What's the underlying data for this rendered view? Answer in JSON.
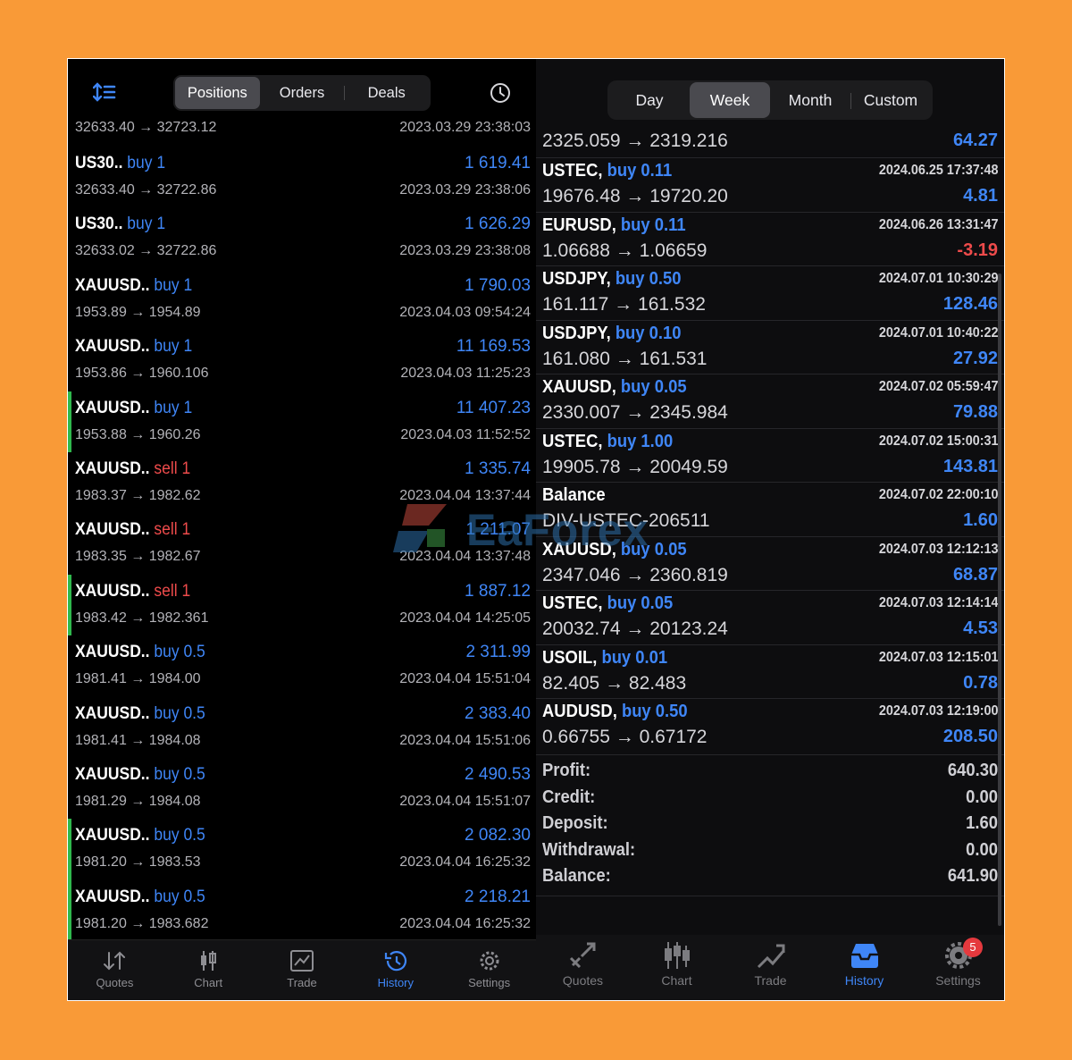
{
  "left": {
    "tabs": [
      "Positions",
      "Orders",
      "Deals"
    ],
    "first_row": {
      "prices": "32633.40 → 32723.12",
      "time": "2023.03.29 23:38:03"
    },
    "rows": [
      {
        "name": "US30..",
        "side": "buy",
        "volume": "1",
        "prices": "32633.40 → 32722.86",
        "profit": "1 619.41",
        "time": "2023.03.29 23:38:06",
        "mark": false
      },
      {
        "name": "US30..",
        "side": "buy",
        "volume": "1",
        "prices": "32633.02 → 32722.86",
        "profit": "1 626.29",
        "time": "2023.03.29 23:38:08",
        "mark": false
      },
      {
        "name": "XAUUSD..",
        "side": "buy",
        "volume": "1",
        "prices": "1953.89 → 1954.89",
        "profit": "1 790.03",
        "time": "2023.04.03 09:54:24",
        "mark": false
      },
      {
        "name": "XAUUSD..",
        "side": "buy",
        "volume": "1",
        "prices": "1953.86 → 1960.106",
        "profit": "11 169.53",
        "time": "2023.04.03 11:25:23",
        "mark": false
      },
      {
        "name": "XAUUSD..",
        "side": "buy",
        "volume": "1",
        "prices": "1953.88 → 1960.26",
        "profit": "11 407.23",
        "time": "2023.04.03 11:52:52",
        "mark": true
      },
      {
        "name": "XAUUSD..",
        "side": "sell",
        "volume": "1",
        "prices": "1983.37 → 1982.62",
        "profit": "1 335.74",
        "time": "2023.04.04 13:37:44",
        "mark": false
      },
      {
        "name": "XAUUSD..",
        "side": "sell",
        "volume": "1",
        "prices": "1983.35 → 1982.67",
        "profit": "1 211.07",
        "time": "2023.04.04 13:37:48",
        "mark": false
      },
      {
        "name": "XAUUSD..",
        "side": "sell",
        "volume": "1",
        "prices": "1983.42 → 1982.361",
        "profit": "1 887.12",
        "time": "2023.04.04 14:25:05",
        "mark": true
      },
      {
        "name": "XAUUSD..",
        "side": "buy",
        "volume": "0.5",
        "prices": "1981.41 → 1984.00",
        "profit": "2 311.99",
        "time": "2023.04.04 15:51:04",
        "mark": false
      },
      {
        "name": "XAUUSD..",
        "side": "buy",
        "volume": "0.5",
        "prices": "1981.41 → 1984.08",
        "profit": "2 383.40",
        "time": "2023.04.04 15:51:06",
        "mark": false
      },
      {
        "name": "XAUUSD..",
        "side": "buy",
        "volume": "0.5",
        "prices": "1981.29 → 1984.08",
        "profit": "2 490.53",
        "time": "2023.04.04 15:51:07",
        "mark": false
      },
      {
        "name": "XAUUSD..",
        "side": "buy",
        "volume": "0.5",
        "prices": "1981.20 → 1983.53",
        "profit": "2 082.30",
        "time": "2023.04.04 16:25:32",
        "mark": true
      },
      {
        "name": "XAUUSD..",
        "side": "buy",
        "volume": "0.5",
        "prices": "1981.20 → 1983.682",
        "profit": "2 218.21",
        "time": "2023.04.04 16:25:32",
        "mark": true
      }
    ],
    "tabbar": [
      "Quotes",
      "Chart",
      "Trade",
      "History",
      "Settings"
    ]
  },
  "right": {
    "periods": [
      "Day",
      "Week",
      "Month",
      "Custom"
    ],
    "first_row": {
      "prices": "2325.059 → 2319.216",
      "profit": "64.27"
    },
    "rows": [
      {
        "name": "USTEC,",
        "action": "buy 0.11",
        "time": "2024.06.25 17:37:48",
        "prices": "19676.48 → 19720.20",
        "profit": "4.81",
        "neg": false
      },
      {
        "name": "EURUSD,",
        "action": "buy 0.11",
        "time": "2024.06.26 13:31:47",
        "prices": "1.06688 → 1.06659",
        "profit": "-3.19",
        "neg": true
      },
      {
        "name": "USDJPY,",
        "action": "buy 0.50",
        "time": "2024.07.01 10:30:29",
        "prices": "161.117 → 161.532",
        "profit": "128.46",
        "neg": false
      },
      {
        "name": "USDJPY,",
        "action": "buy 0.10",
        "time": "2024.07.01 10:40:22",
        "prices": "161.080 → 161.531",
        "profit": "27.92",
        "neg": false
      },
      {
        "name": "XAUUSD,",
        "action": "buy 0.05",
        "time": "2024.07.02 05:59:47",
        "prices": "2330.007 → 2345.984",
        "profit": "79.88",
        "neg": false
      },
      {
        "name": "USTEC,",
        "action": "buy 1.00",
        "time": "2024.07.02 15:00:31",
        "prices": "19905.78 → 20049.59",
        "profit": "143.81",
        "neg": false
      },
      {
        "name": "Balance",
        "action": "",
        "time": "2024.07.02 22:00:10",
        "prices": "DIV-USTEC-206511",
        "profit": "1.60",
        "neg": false
      },
      {
        "name": "XAUUSD,",
        "action": "buy 0.05",
        "time": "2024.07.03 12:12:13",
        "prices": "2347.046 → 2360.819",
        "profit": "68.87",
        "neg": false
      },
      {
        "name": "USTEC,",
        "action": "buy 0.05",
        "time": "2024.07.03 12:14:14",
        "prices": "20032.74 → 20123.24",
        "profit": "4.53",
        "neg": false
      },
      {
        "name": "USOIL,",
        "action": "buy 0.01",
        "time": "2024.07.03 12:15:01",
        "prices": "82.405 → 82.483",
        "profit": "0.78",
        "neg": false
      },
      {
        "name": "AUDUSD,",
        "action": "buy 0.50",
        "time": "2024.07.03 12:19:00",
        "prices": "0.66755 → 0.67172",
        "profit": "208.50",
        "neg": false
      }
    ],
    "summary": [
      {
        "label": "Profit:",
        "value": "640.30"
      },
      {
        "label": "Credit:",
        "value": "0.00"
      },
      {
        "label": "Deposit:",
        "value": "1.60"
      },
      {
        "label": "Withdrawal:",
        "value": "0.00"
      },
      {
        "label": "Balance:",
        "value": "641.90"
      }
    ],
    "tabbar": [
      "Quotes",
      "Chart",
      "Trade",
      "History",
      "Settings"
    ],
    "settings_badge": "5"
  },
  "watermark": "EaForex",
  "colors": {
    "accent_blue": "#3f86f7",
    "sell_red": "#ee4b4b",
    "mark_green": "#2fb84d",
    "background": "#f99a37"
  }
}
